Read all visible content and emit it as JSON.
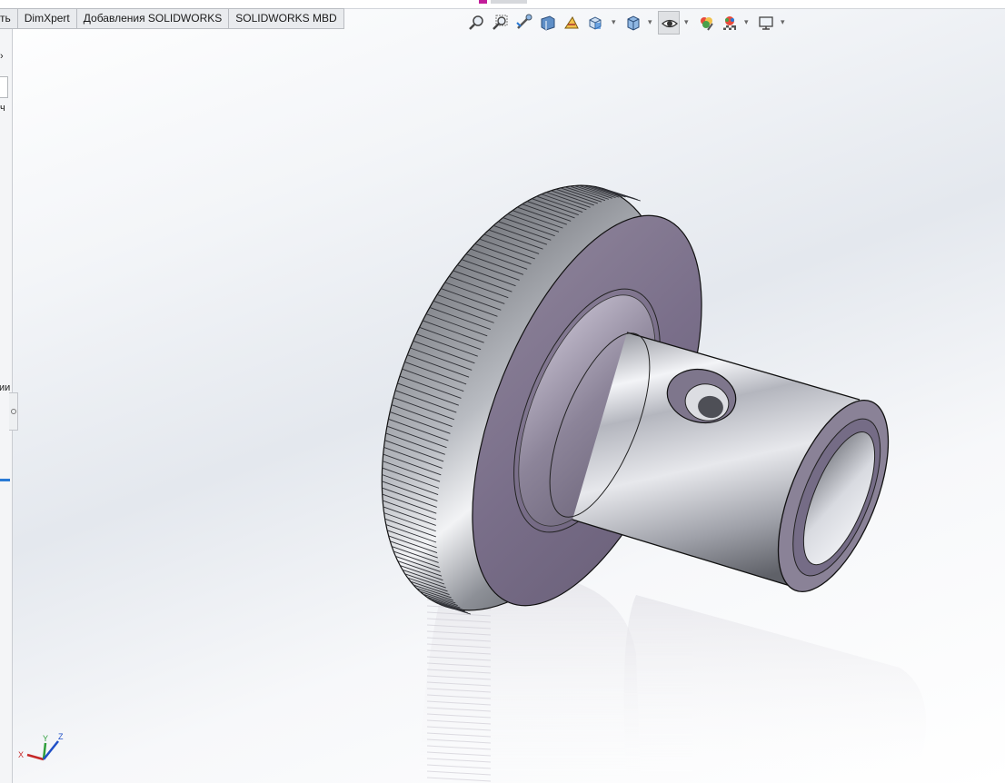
{
  "tabs": [
    {
      "label": "ть"
    },
    {
      "label": "DimXpert"
    },
    {
      "label": "Добавления SOLIDWORKS"
    },
    {
      "label": "SOLIDWORKS MBD"
    }
  ],
  "left_panel": {
    "text_1": "ч",
    "text_2": "ии"
  },
  "heads_up_toolbar": {
    "icons": [
      "zoom-to-fit-icon",
      "zoom-to-area-icon",
      "previous-view-icon",
      "section-view-icon",
      "dynamic-annotation-icon",
      "view-orientation-icon",
      "display-style-icon",
      "hide-show-items-icon",
      "edit-appearance-icon",
      "apply-scene-icon",
      "view-settings-icon"
    ]
  },
  "triad": {
    "x": "X",
    "y": "Y",
    "z": "Z"
  },
  "colors": {
    "accent": "#2a7ad5",
    "face": "#7a6f8a"
  }
}
